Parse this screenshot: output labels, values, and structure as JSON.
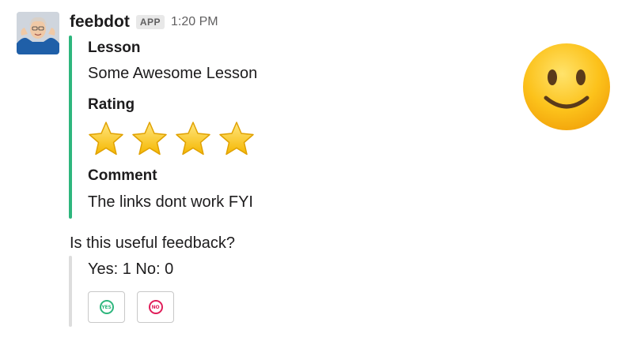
{
  "message": {
    "sender": "feebdot",
    "badge": "APP",
    "timestamp": "1:20 PM"
  },
  "attachment": {
    "accent_color": "#2eb67d",
    "fields": [
      {
        "title": "Lesson",
        "value": "Some Awesome Lesson"
      },
      {
        "title": "Rating",
        "stars": 4,
        "star_icon": "star-icon"
      },
      {
        "title": "Comment",
        "value": "The links dont work FYI"
      }
    ]
  },
  "side_emoji": "slightly-smiling-face-icon",
  "poll": {
    "question": "Is this useful feedback?",
    "counts": "Yes: 1 No: 0",
    "yes_label": "YES",
    "no_label": "NO",
    "yes_color": "#2eb67d",
    "no_color": "#e01e5a"
  }
}
